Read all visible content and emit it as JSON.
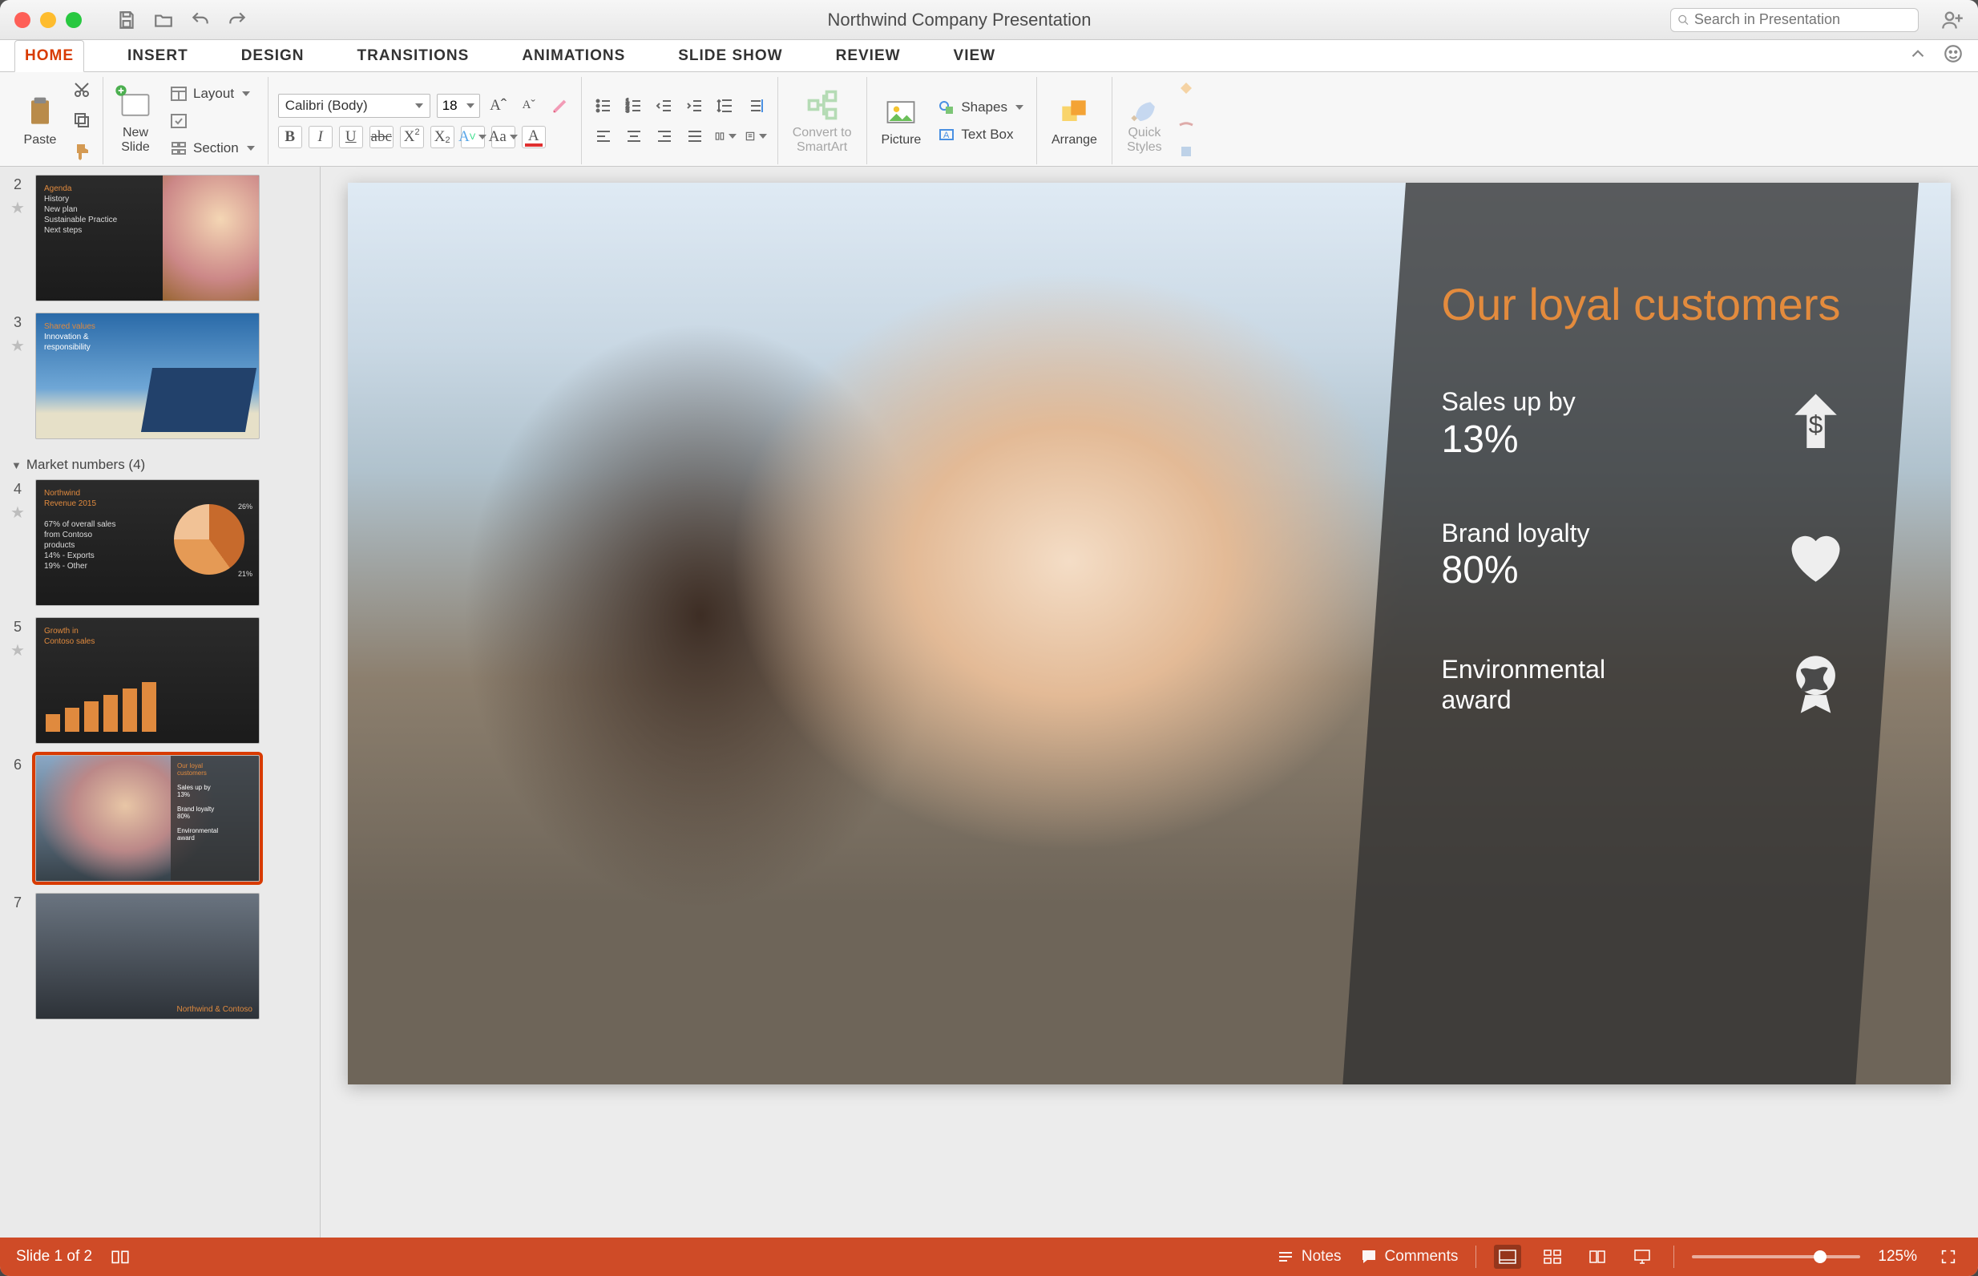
{
  "window": {
    "title": "Northwind Company Presentation"
  },
  "search": {
    "placeholder": "Search in Presentation"
  },
  "tabs": {
    "home": "HOME",
    "insert": "INSERT",
    "design": "DESIGN",
    "transitions": "TRANSITIONS",
    "animations": "ANIMATIONS",
    "slideshow": "SLIDE SHOW",
    "review": "REVIEW",
    "view": "VIEW"
  },
  "ribbon": {
    "paste": "Paste",
    "newslide": "New\nSlide",
    "layout": "Layout",
    "section": "Section",
    "font_name": "Calibri (Body)",
    "font_size": "18",
    "convert": "Convert to\nSmartArt",
    "picture": "Picture",
    "shapes": "Shapes",
    "textbox": "Text Box",
    "arrange": "Arrange",
    "quickstyles": "Quick\nStyles"
  },
  "panel": {
    "section_label": "Market numbers (4)",
    "thumbs": [
      {
        "n": "2"
      },
      {
        "n": "3"
      },
      {
        "n": "4"
      },
      {
        "n": "5"
      },
      {
        "n": "6"
      },
      {
        "n": "7"
      }
    ]
  },
  "slide": {
    "title": "Our loyal customers",
    "metrics": [
      {
        "label": "Sales up by",
        "value": "13%"
      },
      {
        "label": "Brand loyalty",
        "value": "80%"
      },
      {
        "label": "Environmental award",
        "value": ""
      }
    ]
  },
  "status": {
    "slide": "Slide 1 of 2",
    "notes": "Notes",
    "comments": "Comments",
    "zoom": "125%"
  }
}
